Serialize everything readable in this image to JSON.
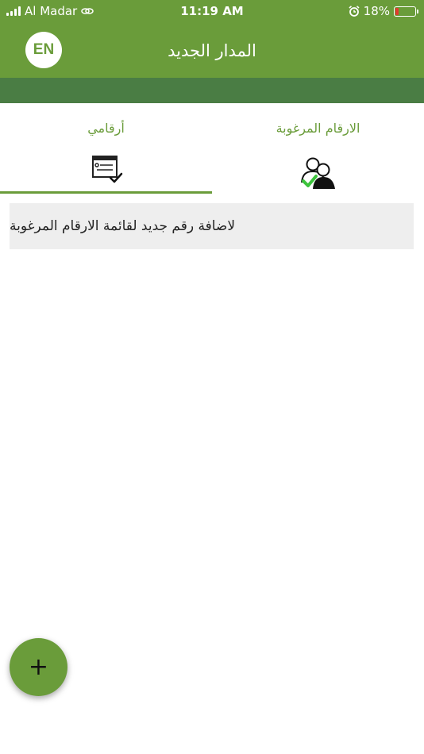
{
  "status_bar": {
    "carrier": "Al Madar",
    "time": "11:19 AM",
    "battery": "18%",
    "battery_level": 0.18
  },
  "header": {
    "language_button": "EN",
    "title": "المدار الجديد"
  },
  "tabs": [
    {
      "label": "الارقام المرغوبة",
      "icon": "users-check-icon",
      "selected": false
    },
    {
      "label": "أرقامي",
      "icon": "card-check-icon",
      "selected": true
    }
  ],
  "list": {
    "add_prompt": "لاضافة رقم جديد لقائمة الارقام المرغوبة"
  },
  "fab": {
    "label": "+"
  },
  "colors": {
    "primary": "#6a9c3a",
    "band": "#4a7d44",
    "row_bg": "#eeeeee"
  }
}
